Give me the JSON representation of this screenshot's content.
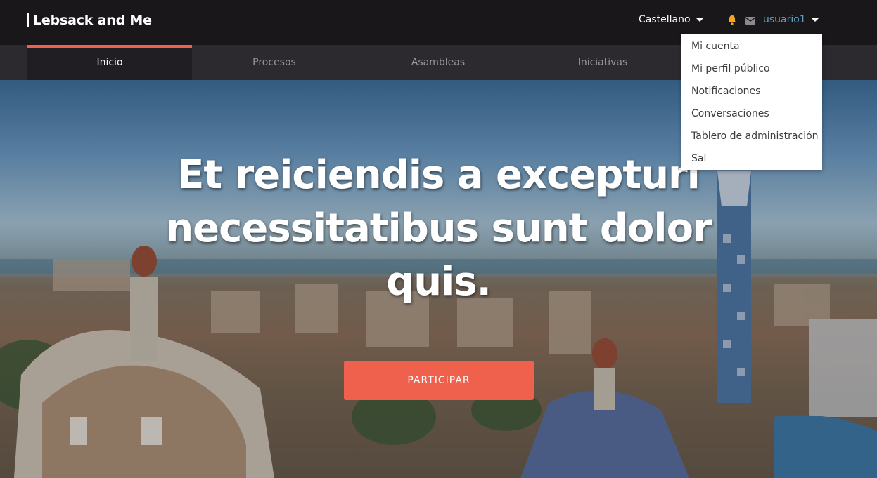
{
  "header": {
    "logo_text": "Lebsack and Me",
    "language": "Castellano",
    "username": "usuario1",
    "icons": {
      "notifications": "bell-icon",
      "messages": "envelope-icon",
      "user_caret": "caret-down-icon",
      "lang_caret": "caret-down-icon"
    },
    "colors": {
      "bell": "#f5a623",
      "username": "#5aa3c9"
    }
  },
  "nav": {
    "items": [
      {
        "label": "Inicio",
        "active": true
      },
      {
        "label": "Procesos",
        "active": false
      },
      {
        "label": "Asambleas",
        "active": false
      },
      {
        "label": "Iniciativas",
        "active": false
      }
    ],
    "accent": "#ef604d"
  },
  "user_menu": {
    "items": [
      {
        "label": "Mi cuenta"
      },
      {
        "label": "Mi perfil público"
      },
      {
        "label": "Notificaciones"
      },
      {
        "label": "Conversaciones"
      },
      {
        "label": "Tablero de administración"
      },
      {
        "label": "Sal"
      }
    ]
  },
  "hero": {
    "title": "Et reiciendis a excepturi necessitatibus sunt dolor quis.",
    "cta_label": "PARTICIPAR",
    "cta_color": "#ef604d"
  }
}
